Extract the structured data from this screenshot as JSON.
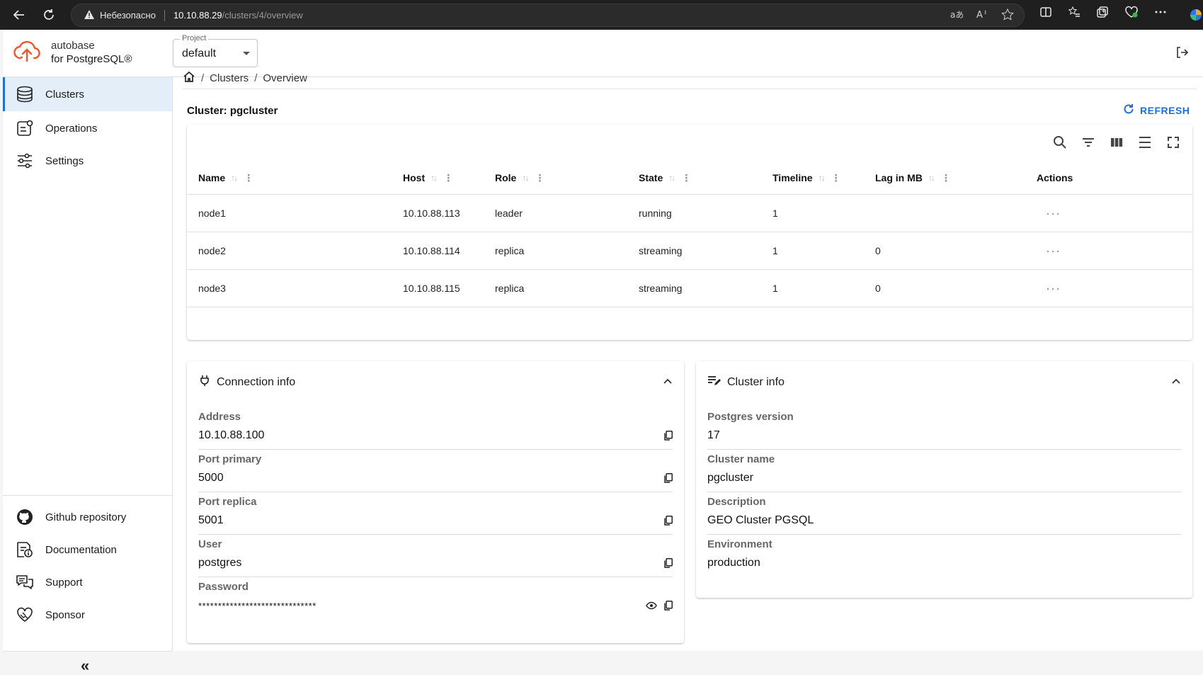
{
  "browser": {
    "insecure_label": "Небезопасно",
    "url_host": "10.10.88.29",
    "url_path": "/clusters/4/overview"
  },
  "app": {
    "brand_line1": "autobase",
    "brand_line2": "for PostgreSQL®",
    "project_label": "Project",
    "project_value": "default",
    "accent_color": "#1f6fd1",
    "logo_color": "#f0552d"
  },
  "sidebar": {
    "items": [
      {
        "label": "Clusters",
        "icon": "database-icon",
        "active": true
      },
      {
        "label": "Operations",
        "icon": "operations-icon"
      },
      {
        "label": "Settings",
        "icon": "sliders-icon"
      }
    ],
    "footer_items": [
      {
        "label": "Github repository",
        "icon": "github-icon"
      },
      {
        "label": "Documentation",
        "icon": "documentation-icon"
      },
      {
        "label": "Support",
        "icon": "support-icon"
      },
      {
        "label": "Sponsor",
        "icon": "sponsor-icon"
      }
    ],
    "collapse_glyph": "«"
  },
  "breadcrumb": {
    "items": [
      "Clusters",
      "Overview"
    ]
  },
  "cluster": {
    "title": "Cluster: pgcluster",
    "refresh_label": "REFRESH"
  },
  "table": {
    "columns": [
      "Name",
      "Host",
      "Role",
      "State",
      "Timeline",
      "Lag in MB",
      "Actions"
    ],
    "rows": [
      {
        "name": "node1",
        "host": "10.10.88.113",
        "role": "leader",
        "state": "running",
        "timeline": "1",
        "lag": ""
      },
      {
        "name": "node2",
        "host": "10.10.88.114",
        "role": "replica",
        "state": "streaming",
        "timeline": "1",
        "lag": "0"
      },
      {
        "name": "node3",
        "host": "10.10.88.115",
        "role": "replica",
        "state": "streaming",
        "timeline": "1",
        "lag": "0"
      }
    ]
  },
  "connection_info": {
    "title": "Connection info",
    "fields": [
      {
        "label": "Address",
        "value": "10.10.88.100"
      },
      {
        "label": "Port primary",
        "value": "5000"
      },
      {
        "label": "Port replica",
        "value": "5001"
      },
      {
        "label": "User",
        "value": "postgres"
      },
      {
        "label": "Password",
        "value": "******************************"
      }
    ]
  },
  "cluster_info": {
    "title": "Cluster info",
    "fields": [
      {
        "label": "Postgres version",
        "value": "17"
      },
      {
        "label": "Cluster name",
        "value": "pgcluster"
      },
      {
        "label": "Description",
        "value": "GEO Cluster PGSQL"
      },
      {
        "label": "Environment",
        "value": "production"
      }
    ]
  }
}
